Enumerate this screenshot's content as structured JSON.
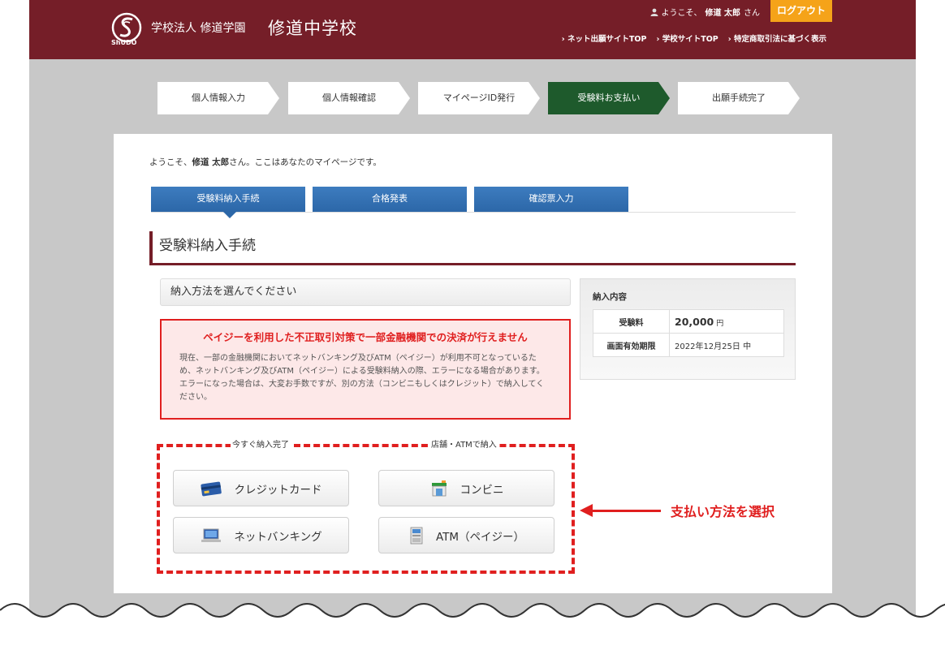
{
  "header": {
    "logo_text": "ShUDO",
    "corp_name": "学校法人 修道学園",
    "school_name": "修道中学校",
    "welcome": "ようこそ、",
    "user_name": "修道 太郎",
    "welcome_suffix": "さん",
    "logout_label": "ログアウト",
    "links": [
      "ネット出願サイトTOP",
      "学校サイトTOP",
      "特定商取引法に基づく表示"
    ]
  },
  "steps": [
    {
      "label": "個人情報入力",
      "active": false
    },
    {
      "label": "個人情報確認",
      "active": false
    },
    {
      "label": "マイページID発行",
      "active": false
    },
    {
      "label": "受験料お支払い",
      "active": true
    },
    {
      "label": "出願手続完了",
      "active": false
    }
  ],
  "intro": {
    "prefix": "ようこそ、",
    "name": "修道 太郎",
    "suffix": "さん。ここはあなたのマイページです。"
  },
  "tabs": [
    "受験料納入手続",
    "合格発表",
    "確認票入力"
  ],
  "section_title": "受験料納入手続",
  "method_heading": "納入方法を選んでください",
  "notice": {
    "title": "ペイジーを利用した不正取引対策で一部金融機関での決済が行えません",
    "body": "現在、一部の金融機関においてネットバンキング及びATM（ペイジー）が利用不可となっているため、ネットバンキング及びATM（ペイジー）による受験料納入の際、エラーになる場合があります。エラーになった場合は、大変お手数ですが、別の方法（コンビニもしくはクレジット）で納入してください。"
  },
  "payment": {
    "label_now": "今すぐ納入完了",
    "label_store": "店舗・ATMで納入",
    "credit": "クレジットカード",
    "conveni": "コンビニ",
    "netbank": "ネットバンキング",
    "atm": "ATM（ペイジー）"
  },
  "summary": {
    "title": "納入内容",
    "fee_label": "受験料",
    "fee_amount": "20,000",
    "fee_unit": "円",
    "deadline_label": "画面有効期限",
    "deadline_value": "2022年12月25日 中"
  },
  "callout": "支払い方法を選択",
  "colors": {
    "header": "#751e28",
    "active_step": "#1e5a2c",
    "tab": "#2c67a8",
    "alert": "#e01f1f",
    "logout": "#f5a319"
  }
}
